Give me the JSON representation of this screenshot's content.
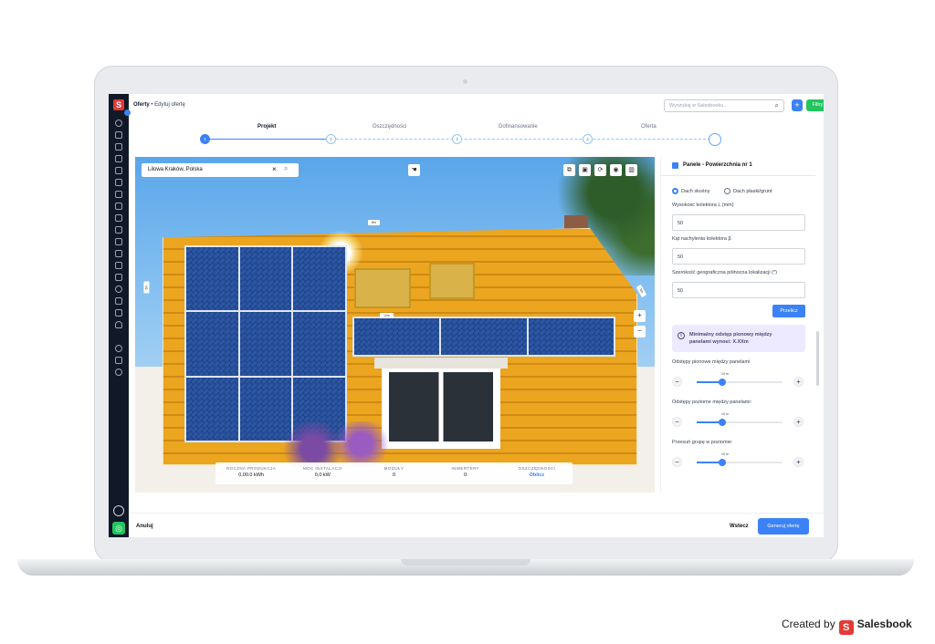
{
  "app": {
    "breadcrumb_root": "Oferty",
    "breadcrumb_sep": "•",
    "breadcrumb_current": "Edytuj ofertę"
  },
  "header": {
    "search_placeholder": "Wyszukaj w Salesbooku...",
    "add_label": "+",
    "filters_label": "Filtry ⌄"
  },
  "steps": [
    {
      "label": "Projekt",
      "number": "1",
      "active": true
    },
    {
      "label": "Oszczędności",
      "number": "2"
    },
    {
      "label": "Dofinansowanie",
      "number": "3"
    },
    {
      "label": "Oferta",
      "number": "4"
    }
  ],
  "map": {
    "location_value": "Lilowa Kraków, Polska",
    "clear_icon": "×",
    "measure_top": "8m",
    "measure_side": "6m",
    "measure_mid": "12m",
    "measure_right": "9m",
    "zoom_in": "+",
    "zoom_out": "−"
  },
  "stats": [
    {
      "label": "ROCZNA PRODUKCJA",
      "value": "0,00.0 kWh"
    },
    {
      "label": "MOC INSTALACJI",
      "value": "0,0 kW"
    },
    {
      "label": "MODUŁY",
      "value": "0"
    },
    {
      "label": "INWERTERY",
      "value": "0"
    },
    {
      "label": "OSZCZĘDNOŚCI",
      "value": "Oblicz"
    }
  ],
  "panel": {
    "title": "Panele - Powierzchnia nr 1",
    "roof_option_1": "Dach skośny",
    "roof_option_2": "Dach płaski/grunt",
    "field_1_label": "Wysokość kolektora L (mm)",
    "field_1_value": "50",
    "field_2_label": "Kąt nachylenia kolektora β",
    "field_2_value": "50",
    "field_3_label": "Szerokość geograficzna północna lokalizacji (*)",
    "field_3_value": "50",
    "recalc_label": "Przelicz",
    "info_line_1": "Minimalny odstęp pionowy między",
    "info_line_2": "panelami wynosi: X.XXm",
    "slider_1_label": "Odstępy pionowe między panelami",
    "slider_2_label": "Odstępy poziome między panelami:",
    "slider_3_label": "Przesuń grupę w poziomie:",
    "slider_value": "10 m",
    "slider_level": 0.3
  },
  "footer": {
    "cancel_label": "Anuluj",
    "back_label": "Wstecz",
    "generate_label": "Generuj ofertę"
  },
  "credit": {
    "prefix": "Created by",
    "brand": "Salesbook"
  },
  "colors": {
    "accent": "#3b82f6",
    "green": "#22c55e",
    "sidebar": "#111827",
    "roof": "#eba51f"
  }
}
